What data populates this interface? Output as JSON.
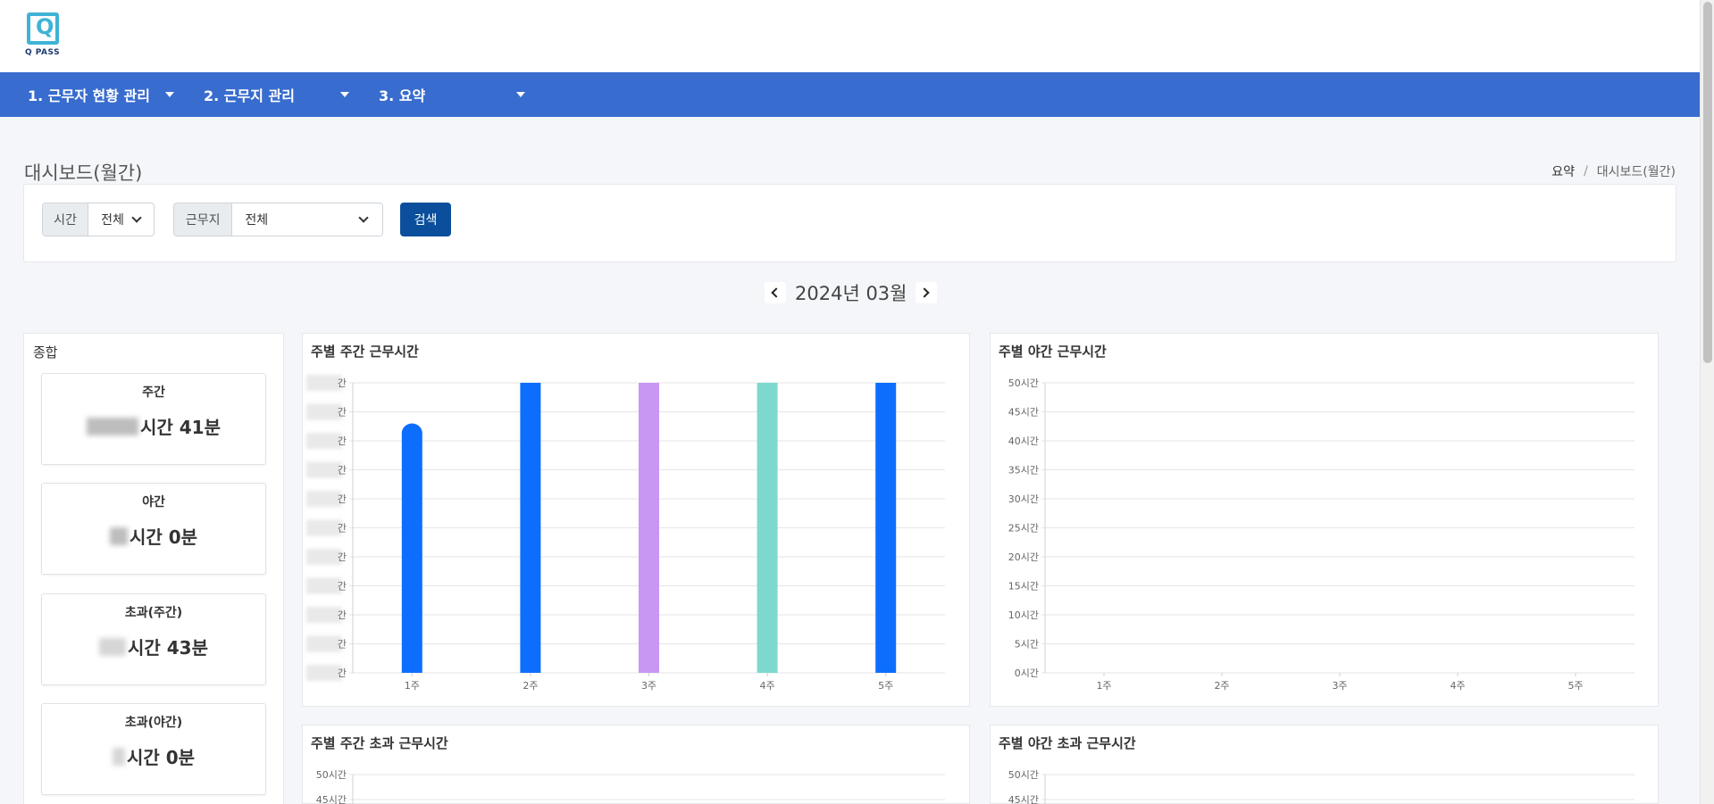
{
  "header": {
    "logo_text": "Q PASS",
    "logo_glyph": "Q",
    "nav": [
      {
        "label": "1. 근무자 현황 관리"
      },
      {
        "label": "2. 근무지 관리"
      },
      {
        "label": "3. 요약"
      }
    ]
  },
  "page": {
    "title": "대시보드(월간)",
    "breadcrumb": [
      "요약",
      "대시보드(월간)"
    ],
    "breadcrumb_sep": "/"
  },
  "filters": {
    "time_label": "시간",
    "time_value": "전체",
    "site_label": "근무지",
    "site_value": "전체",
    "search_label": "검색"
  },
  "month_nav": {
    "label": "2024년 03월"
  },
  "summary": {
    "title": "종합",
    "items": [
      {
        "label": "주간",
        "value": "시간 41분"
      },
      {
        "label": "야간",
        "value": "시간 0분"
      },
      {
        "label": "초과(주간)",
        "value": "시간 43분"
      },
      {
        "label": "초과(야간)",
        "value": "시간 0분"
      }
    ]
  },
  "colors": {
    "navbar": "#386ccf",
    "search_button": "#0b4f9c",
    "bar_blue": "#0d6efd",
    "bar_purple": "#c797f3",
    "bar_teal": "#7dd9cd"
  },
  "chart_data": [
    {
      "type": "bar",
      "title": "주별 주간 근무시간",
      "categories": [
        "1주",
        "2주",
        "3주",
        "4주",
        "5주"
      ],
      "values": [
        43,
        50,
        50,
        50,
        50
      ],
      "bar_colors": [
        "#0d6efd",
        "#0d6efd",
        "#c797f3",
        "#7dd9cd",
        "#0d6efd"
      ],
      "y_tick_labels": [
        "간",
        "간",
        "간",
        "간",
        "간",
        "간",
        "간",
        "간",
        "간",
        "간",
        "간"
      ],
      "ylim": [
        0,
        50
      ],
      "grid": true
    },
    {
      "type": "bar",
      "title": "주별 야간 근무시간",
      "categories": [
        "1주",
        "2주",
        "3주",
        "4주",
        "5주"
      ],
      "values": [
        0,
        0,
        0,
        0,
        0
      ],
      "y_tick_labels": [
        "0시간",
        "5시간",
        "10시간",
        "15시간",
        "20시간",
        "25시간",
        "30시간",
        "35시간",
        "40시간",
        "45시간",
        "50시간"
      ],
      "ylim": [
        0,
        50
      ],
      "grid": true
    },
    {
      "type": "bar",
      "title": "주별 주간 초과 근무시간",
      "categories": [],
      "values": [],
      "y_tick_labels_visible": [
        "50시간",
        "45시간"
      ],
      "ylim": [
        0,
        50
      ],
      "grid": true
    },
    {
      "type": "bar",
      "title": "주별 야간 초과 근무시간",
      "categories": [],
      "values": [],
      "y_tick_labels_visible": [
        "50시간",
        "45시간"
      ],
      "ylim": [
        0,
        50
      ],
      "grid": true
    }
  ]
}
